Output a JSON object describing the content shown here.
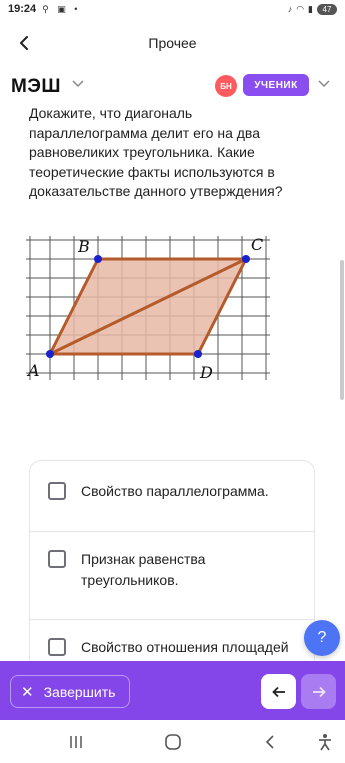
{
  "status_bar": {
    "time": "19:24",
    "battery": "47"
  },
  "nav": {
    "title": "Прочее"
  },
  "header": {
    "logo": "МЭШ",
    "avatar_initials": "БН",
    "role": "УЧЕНИК"
  },
  "question": {
    "text": "Докажите, что диагональ параллелограмма делит его на два равновеликих треугольника. Какие теоретические факты используются в доказательстве данного утверждения?"
  },
  "figure": {
    "labels": {
      "a": "A",
      "b": "B",
      "c": "C",
      "d": "D"
    },
    "fill_color": "#e8b8a6",
    "stroke_color": "#b55a2a",
    "point_color": "#1a22cc"
  },
  "answers": [
    {
      "label": "Свойство параллелограмма.",
      "checked": false
    },
    {
      "label": "Признак равенства треугольников.",
      "checked": false
    },
    {
      "label": "Свойство отношения площадей",
      "checked": false
    }
  ],
  "help": {
    "label": "?"
  },
  "footer": {
    "finish_label": "Завершить"
  },
  "colors": {
    "accent": "#8446e8",
    "help": "#4d74f5",
    "badge": "#8a4ef0",
    "avatar": "#ff5a5f"
  }
}
